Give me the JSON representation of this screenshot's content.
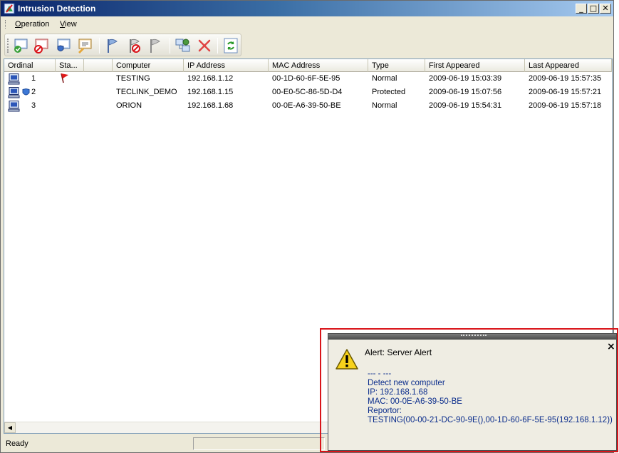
{
  "window": {
    "title": "Intrusion Detection",
    "controls": {
      "minimize": "_",
      "maximize": "□",
      "close": "✕"
    }
  },
  "menu": {
    "items": [
      {
        "label": "Operation",
        "accel": "O"
      },
      {
        "label": "View",
        "accel": "V"
      }
    ]
  },
  "toolbar": {
    "buttons": [
      {
        "icon": "approve-computer-icon"
      },
      {
        "icon": "block-computer-icon"
      },
      {
        "icon": "protect-computer-icon"
      },
      {
        "icon": "edit-computer-icon"
      },
      {
        "icon": "flag-icon"
      },
      {
        "icon": "unflag-icon"
      },
      {
        "icon": "flag-gray-icon"
      },
      {
        "icon": "network-computers-icon"
      },
      {
        "icon": "delete-icon"
      },
      {
        "icon": "refresh-icon"
      }
    ]
  },
  "table": {
    "columns": [
      "Ordinal",
      "Sta...",
      "",
      "Computer",
      "IP Address",
      "MAC Address",
      "Type",
      "First Appeared",
      "Last Appeared"
    ],
    "rows": [
      {
        "ordinal": "1",
        "status_icon": "red-flag-icon",
        "computer": "TESTING",
        "ip": "192.168.1.12",
        "mac": "00-1D-60-6F-5E-95",
        "type": "Normal",
        "first": "2009-06-19 15:03:39",
        "last": "2009-06-19 15:57:35"
      },
      {
        "ordinal": "2",
        "status_icon": "shield-icon",
        "computer": "TECLINK_DEMO",
        "ip": "192.168.1.15",
        "mac": "00-E0-5C-86-5D-D4",
        "type": "Protected",
        "first": "2009-06-19 15:07:56",
        "last": "2009-06-19 15:57:21"
      },
      {
        "ordinal": "3",
        "status_icon": "",
        "computer": "ORION",
        "ip": "192.168.1.68",
        "mac": "00-0E-A6-39-50-BE",
        "type": "Normal",
        "first": "2009-06-19 15:54:31",
        "last": "2009-06-19 15:57:18"
      }
    ]
  },
  "statusbar": {
    "text": "Ready"
  },
  "alert": {
    "title": "Alert: Server Alert",
    "lines": [
      "--- - ---",
      "Detect new computer",
      "IP: 192.168.1.68",
      "MAC: 00-0E-A6-39-50-BE",
      "Reportor:",
      "TESTING(00-00-21-DC-90-9E(),00-1D-60-6F-5E-95(192.168.1.12))"
    ],
    "close": "×"
  },
  "colors": {
    "alert_text": "#0b2d8c",
    "highlight_border": "#d9141a",
    "title_gradient_start": "#0a246a"
  }
}
